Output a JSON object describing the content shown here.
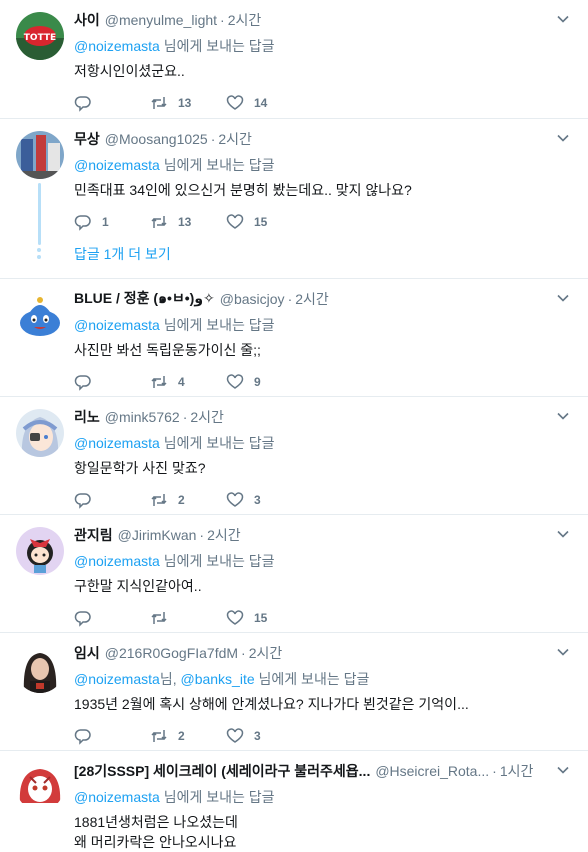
{
  "reply_suffix": "님에게 보내는 답글",
  "tweets": [
    {
      "name": "사이",
      "handle": "@menyulme_light",
      "time": "2시간",
      "mention": "@noizemasta",
      "text": "저항시인이셨군요..",
      "retweets": "13",
      "likes": "14",
      "replies": ""
    },
    {
      "name": "무상",
      "handle": "@Moosang1025",
      "time": "2시간",
      "mention": "@noizemasta",
      "text": "민족대표 34인에 있으신거 분명히 봤는데요.. 맞지 않나요?",
      "replies": "1",
      "retweets": "13",
      "likes": "15",
      "more_replies": "답글 1개 더 보기"
    },
    {
      "name": "BLUE / 정훈 (๑•ㅂ•)و✧",
      "handle": "@basicjoy",
      "time": "2시간",
      "mention": "@noizemasta",
      "text": "사진만 봐선 독립운동가이신 줄;;",
      "replies": "",
      "retweets": "4",
      "likes": "9"
    },
    {
      "name": "리노",
      "handle": "@mink5762",
      "time": "2시간",
      "mention": "@noizemasta",
      "text": "항일문학가 사진 맞죠?",
      "replies": "",
      "retweets": "2",
      "likes": "3"
    },
    {
      "name": "관지림",
      "handle": "@JirimKwan",
      "time": "2시간",
      "mention": "@noizemasta",
      "text": "구한말 지식인같아여..",
      "replies": "",
      "retweets": "",
      "likes": "15"
    },
    {
      "name": "임시",
      "handle": "@216R0GogFIa7fdM",
      "time": "2시간",
      "mention": "@noizemasta",
      "mention_sep": "님, ",
      "mention2": "@banks_ite",
      "text": "1935년 2월에 혹시 상해에 안계셨나요? 지나가다 뵌것같은 기억이...",
      "replies": "",
      "retweets": "2",
      "likes": "3"
    },
    {
      "name": "[28기SSSP] 세이크레이 (세레이라구 불러주세욥...",
      "handle": "@Hseicrei_Rota...",
      "time": "1시간",
      "mention": "@noizemasta",
      "text_line1": "1881년생처럼은 나오셨는데",
      "text_line2": "왜 머리카락은 안나오시나요"
    }
  ],
  "colors": {
    "accent": "#1da1f2",
    "muted": "#657786",
    "thread": "#b7dff8"
  }
}
